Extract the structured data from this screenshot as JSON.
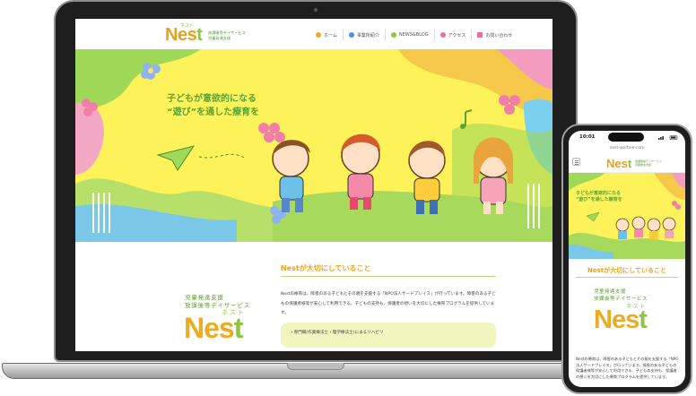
{
  "laptop": {
    "site": {
      "logo": {
        "word_ne": "Ne",
        "word_s": "s",
        "word_t": "t",
        "kana": "ネスト",
        "sub_line1": "放課後等デイサービス",
        "sub_line2": "児童発達支援"
      },
      "nav": [
        {
          "label": "ホーム",
          "icon": "home-icon",
          "color": "#f5a623"
        },
        {
          "label": "事業所紹介",
          "icon": "info-icon",
          "color": "#4a90e2"
        },
        {
          "label": "NEWS&BLOG",
          "icon": "news-icon",
          "color": "#8cc63f"
        },
        {
          "label": "アクセス",
          "icon": "map-pin-icon",
          "color": "#e86aa6"
        },
        {
          "label": "お問い合わせ",
          "icon": "mail-icon",
          "color": "#e86aa6"
        }
      ],
      "hero": {
        "line1": "子どもが意欲的になる",
        "line2": "“遊び”を通した療育を"
      },
      "section": {
        "title": "Nestが大切にしていること",
        "paragraph": "Nestの療育は、障害のある子どもとその親を支援する「NPO法人サードプレイス」が行っています。障害のある子どもの保護者様等が安心して利用できる、子どもの支持も、保護者の想いを大切にした療育プログラムを提供しています。",
        "callout": "・専門職(作業療法士・理学療法士)によるリハビリ"
      },
      "big_logo": {
        "line1": "児童発達支援",
        "line2": "放課後等デイサービス",
        "kana": "ネスト",
        "word_ne": "Ne",
        "word_s": "s",
        "word_t": "t"
      }
    }
  },
  "phone": {
    "status_time": "10:01",
    "url": "nest-welfare.com",
    "logo": {
      "word_ne": "Ne",
      "word_s": "s",
      "word_t": "t",
      "sub_line1": "放課後等デイサービス",
      "sub_line2": "児童発達支援"
    },
    "hero": {
      "line1": "子どもが意欲的になる",
      "line2": "“遊び”を通した療育を"
    },
    "section_title": "Nestが大切にしていること",
    "big_logo": {
      "line1": "児童発達支援",
      "line2": "放課後等デイサービス",
      "kana": "ネスト",
      "word_ne": "Ne",
      "word_s": "s",
      "word_t": "t"
    },
    "paragraph": "Nestの療育は、障害のある子どもとその親を支援する「NPO法人サードプレイス」が行っています。障害のある子どもの保護者様等が安心して利用できる、子どもの支持も、保護者の想いを大切にした療育プログラムを提供しています。"
  }
}
